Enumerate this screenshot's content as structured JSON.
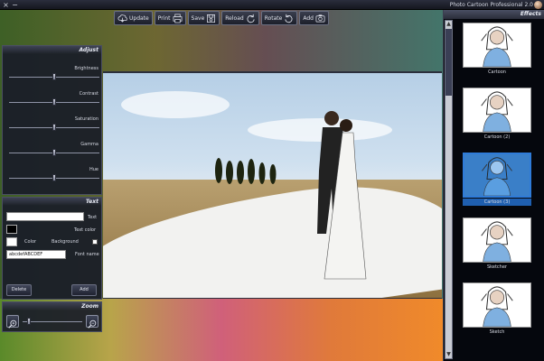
{
  "titlebar": {
    "title": "Photo Cartoon Professional 2.0",
    "buttons": [
      "×",
      "−"
    ]
  },
  "toolbar": {
    "buttons": [
      {
        "label": "Update",
        "icon": "cloud-download-icon"
      },
      {
        "label": "Print",
        "icon": "printer-icon"
      },
      {
        "label": "Save",
        "icon": "save-icon"
      },
      {
        "label": "Reload",
        "icon": "reload-icon"
      },
      {
        "label": "Rotate",
        "icon": "rotate-icon"
      },
      {
        "label": "Add",
        "icon": "camera-icon"
      }
    ]
  },
  "adjust": {
    "title": "Adjust",
    "sliders": [
      {
        "label": "Brightness",
        "value": 0.5
      },
      {
        "label": "Contrast",
        "value": 0.5
      },
      {
        "label": "Saturation",
        "value": 0.5
      },
      {
        "label": "Gamma",
        "value": 0.5
      },
      {
        "label": "Hue",
        "value": 0.5
      }
    ]
  },
  "text": {
    "title": "Text",
    "text_label": "Text",
    "text_value": "",
    "text_color_label": "Text color",
    "background_label": "Background",
    "color_label": "Color",
    "font_name_label": "Font name",
    "font_value": "abcdefABCDEF",
    "add_label": "Add",
    "delete_label": "Delete"
  },
  "zoom": {
    "title": "Zoom",
    "value": 0.1
  },
  "effects": {
    "title": "Effects",
    "items": [
      {
        "label": "Cartoon",
        "selected": false
      },
      {
        "label": "Cartoon (2)",
        "selected": false
      },
      {
        "label": "Cartoon (3)",
        "selected": true
      },
      {
        "label": "Sketcher",
        "selected": false
      },
      {
        "label": "Sketch",
        "selected": false
      }
    ]
  }
}
